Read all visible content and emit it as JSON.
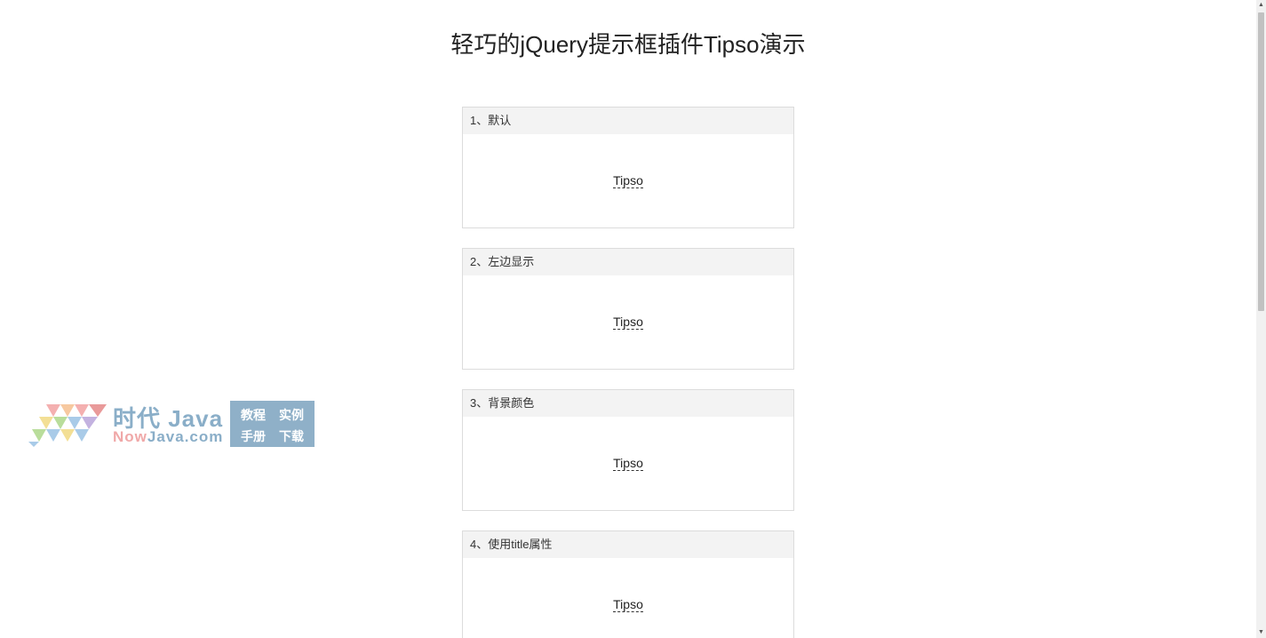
{
  "page": {
    "title": "轻巧的jQuery提示框插件Tipso演示"
  },
  "demos": [
    {
      "heading": "1、默认",
      "link": "Tipso"
    },
    {
      "heading": "2、左边显示",
      "link": "Tipso"
    },
    {
      "heading": "3、背景颜色",
      "link": "Tipso"
    },
    {
      "heading": "4、使用title属性",
      "link": "Tipso"
    }
  ],
  "watermark": {
    "name": "时代 Java",
    "site_part1": "Now",
    "site_part2": "Java.com",
    "cells": [
      "教程",
      "实例",
      "手册",
      "下载"
    ]
  },
  "scrollbar": {
    "up_arrow": "▲",
    "down_arrow": "▼"
  },
  "colors": {
    "background": "#ffffff",
    "panel_header": "#f3f3f3",
    "border": "#dcdcdc",
    "watermark_blue": "#8fb0c8"
  }
}
